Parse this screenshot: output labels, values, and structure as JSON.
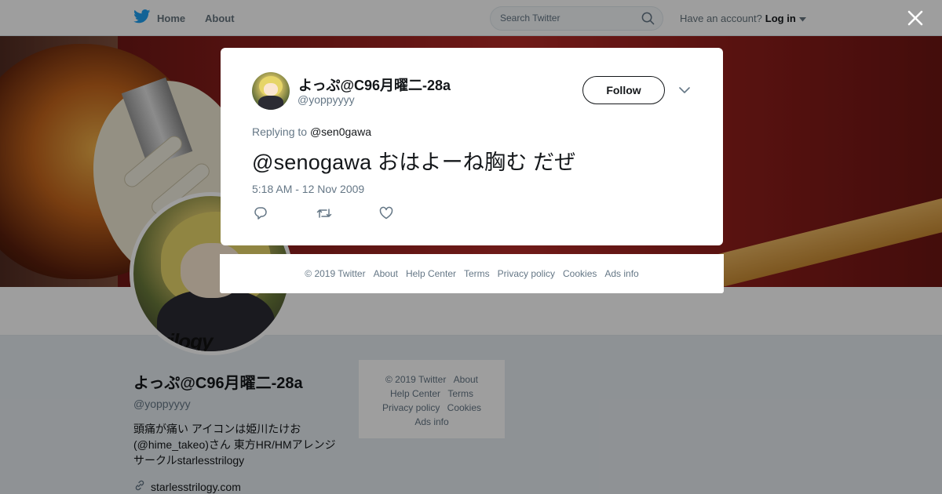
{
  "nav": {
    "home_label": "Home",
    "about_label": "About",
    "search_placeholder": "Search Twitter",
    "account_prompt": "Have an account?",
    "login_label": "Log in"
  },
  "profile": {
    "name": "よっぷ@C96月曜二-28a",
    "handle": "@yoppyyyy",
    "bio": "頭痛が痛い アイコンは姫川たけお\n(@hime_takeo)さん 東方HR/HMアレンジ\nサークルstarlesstrilogy",
    "link": "starlesstrilogy.com",
    "avatar_text": "trilogy"
  },
  "side_footer": {
    "copyright": "© 2019 Twitter",
    "about": "About",
    "help": "Help Center",
    "terms": "Terms",
    "privacy": "Privacy policy",
    "cookies": "Cookies",
    "ads": "Ads info"
  },
  "tweet": {
    "author_name": "よっぷ@C96月曜二-28a",
    "author_handle": "@yoppyyyy",
    "follow_label": "Follow",
    "replying_prefix": "Replying to",
    "replying_to": "@sen0gawa",
    "text": "@senogawa おはよーね胸む だぜ",
    "timestamp": "5:18 AM - 12 Nov 2009"
  },
  "modal_footer": {
    "copyright": "© 2019 Twitter",
    "about": "About",
    "help": "Help Center",
    "terms": "Terms",
    "privacy": "Privacy policy",
    "cookies": "Cookies",
    "ads": "Ads info"
  },
  "icons": {
    "brand": "twitter-bird-icon",
    "search": "search-icon",
    "close": "close-icon",
    "reply": "reply-icon",
    "retweet": "retweet-icon",
    "like": "heart-icon",
    "link": "link-icon",
    "caret": "chevron-down-icon"
  },
  "colors": {
    "brand_blue": "#1da1f2",
    "text_primary": "#14171a",
    "text_secondary": "#657786",
    "background": "#e6ecf0"
  }
}
